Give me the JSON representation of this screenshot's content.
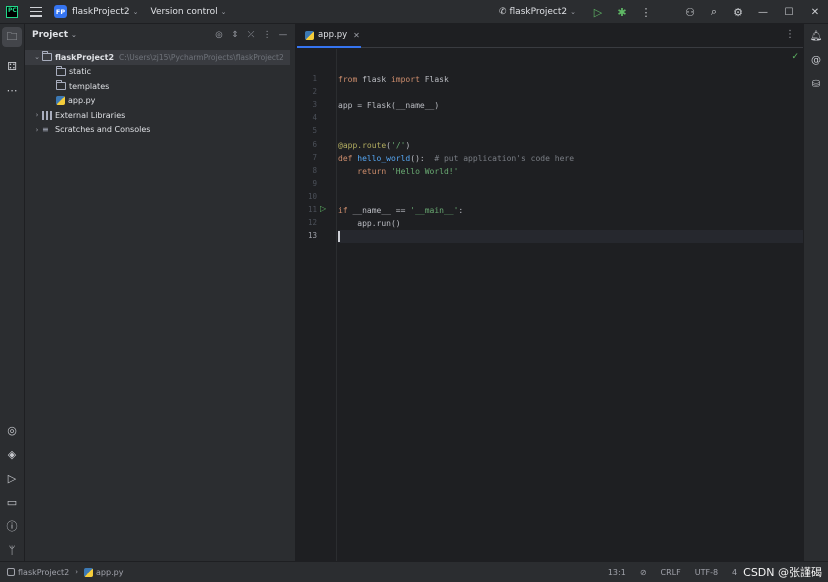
{
  "titlebar": {
    "project_badge": "FP",
    "project_name": "flaskProject2",
    "version_control": "Version control",
    "run_config": "flaskProject2"
  },
  "project_panel": {
    "title": "Project",
    "tree": [
      {
        "label": "flaskProject2",
        "path": "C:\\Users\\zj15\\PycharmProjects\\flaskProject2",
        "kind": "folder",
        "expanded": true,
        "selected": true
      },
      {
        "label": "static",
        "kind": "folder"
      },
      {
        "label": "templates",
        "kind": "folder"
      },
      {
        "label": "app.py",
        "kind": "python-file"
      },
      {
        "label": "External Libraries",
        "kind": "library"
      },
      {
        "label": "Scratches and Consoles",
        "kind": "scratches"
      }
    ]
  },
  "editor": {
    "tab_label": "app.py",
    "current_line": 13,
    "line_numbers": [
      "1",
      "2",
      "3",
      "4",
      "5",
      "6",
      "7",
      "8",
      "9",
      "10",
      "11",
      "12",
      "13"
    ],
    "lines": [
      [
        {
          "t": "from",
          "c": "kw"
        },
        {
          "t": " flask ",
          "c": ""
        },
        {
          "t": "import",
          "c": "kw"
        },
        {
          "t": " Flask",
          "c": ""
        }
      ],
      [],
      [
        {
          "t": "app = Flask(__name__)",
          "c": ""
        }
      ],
      [],
      [],
      [
        {
          "t": "@app.route",
          "c": "dec"
        },
        {
          "t": "(",
          "c": ""
        },
        {
          "t": "'/'",
          "c": "str"
        },
        {
          "t": ")",
          "c": ""
        }
      ],
      [
        {
          "t": "def ",
          "c": "kw"
        },
        {
          "t": "hello_world",
          "c": "fn"
        },
        {
          "t": "():  ",
          "c": ""
        },
        {
          "t": "# put application's code here",
          "c": "cmt"
        }
      ],
      [
        {
          "t": "    ",
          "c": ""
        },
        {
          "t": "return ",
          "c": "kw"
        },
        {
          "t": "'Hello World!'",
          "c": "str"
        }
      ],
      [],
      [],
      [
        {
          "t": "if ",
          "c": "kw"
        },
        {
          "t": "__name__ == ",
          "c": ""
        },
        {
          "t": "'__main__'",
          "c": "str"
        },
        {
          "t": ":",
          "c": ""
        }
      ],
      [
        {
          "t": "    app.run()",
          "c": ""
        }
      ],
      []
    ]
  },
  "statusbar": {
    "breadcrumb_project": "flaskProject2",
    "breadcrumb_file": "app.py",
    "position": "13:1",
    "line_sep": "CRLF",
    "encoding": "UTF-8",
    "indent": "4",
    "watermark": "CSDN @张謹碣"
  },
  "colors": {
    "accent": "#3574f0",
    "run_green": "#5fb865",
    "keyword": "#cf8e6d",
    "string": "#6aab73",
    "function": "#56a8f5",
    "decorator": "#b3ae60",
    "comment": "#7a7e85"
  }
}
